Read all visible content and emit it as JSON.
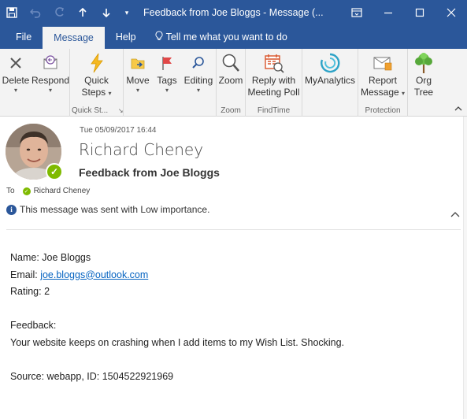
{
  "titlebar": {
    "title": "Feedback from Joe Bloggs  -  Message (...",
    "icons": [
      "save-icon",
      "undo-icon",
      "redo-icon",
      "up-arrow-icon",
      "down-arrow-icon",
      "customize-icon",
      "restore-ribbon-icon",
      "minimize-icon",
      "maximize-icon",
      "close-icon"
    ]
  },
  "tabs": {
    "file": "File",
    "message": "Message",
    "help": "Help",
    "tell_me": "Tell me what you want to do"
  },
  "ribbon": {
    "delete": {
      "label": "Delete"
    },
    "respond": {
      "label": "Respond"
    },
    "quick_steps": {
      "label1": "Quick",
      "label2": "Steps",
      "group": "Quick St..."
    },
    "move": {
      "label": "Move"
    },
    "tags": {
      "label": "Tags"
    },
    "editing": {
      "label": "Editing"
    },
    "zoom": {
      "label": "Zoom",
      "group": "Zoom"
    },
    "reply_poll": {
      "label1": "Reply with",
      "label2": "Meeting Poll",
      "group": "FindTime"
    },
    "myanalytics": {
      "label": "MyAnalytics"
    },
    "report": {
      "label1": "Report",
      "label2": "Message",
      "group": "Protection"
    },
    "org_tree": {
      "label1": "Org",
      "label2": "Tree"
    }
  },
  "message": {
    "date": "Tue 05/09/2017 16:44",
    "sender": "Richard Cheney",
    "subject": "Feedback from Joe Bloggs",
    "to_label": "To",
    "to_name": "Richard Cheney",
    "importance": "This message was sent with Low importance."
  },
  "body": {
    "name": "Name: Joe Bloggs",
    "email_label": "Email: ",
    "email": "joe.bloggs@outlook.com",
    "rating": "Rating: 2",
    "feedback_label": "Feedback:",
    "feedback": "Your website keeps on crashing when I add items to my Wish List.  Shocking.",
    "source": "Source: webapp, ID: 1504522921969"
  },
  "colors": {
    "brand": "#2b579a",
    "presence": "#7fba00",
    "link": "#0563c1"
  }
}
